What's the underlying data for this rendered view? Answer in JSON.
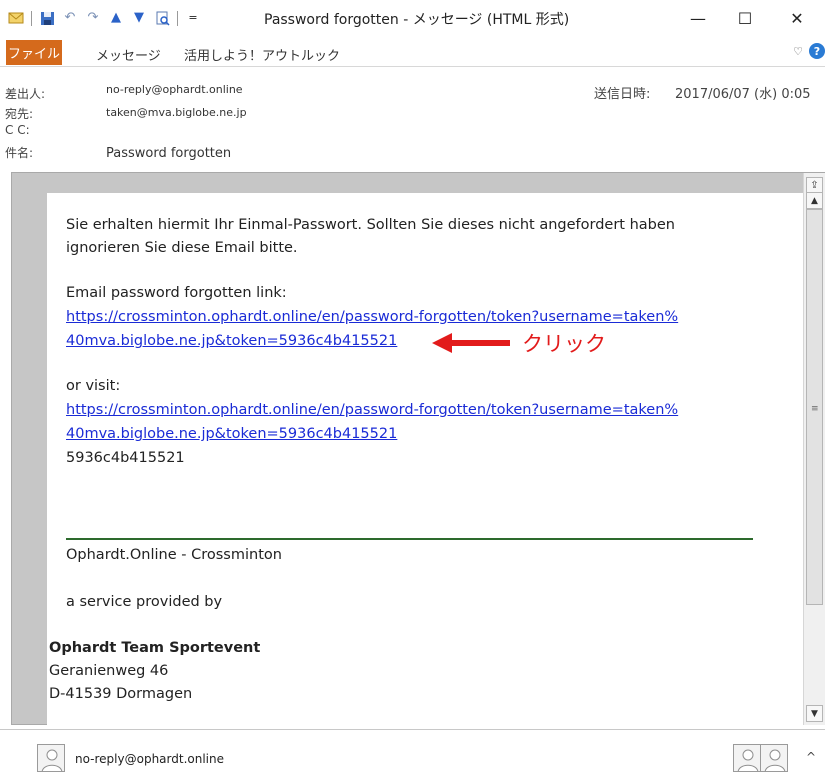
{
  "window": {
    "title": "Password forgotten - メッセージ (HTML 形式)",
    "minimize": "—",
    "maximize": "☐",
    "close": "✕"
  },
  "ribbon": {
    "file_tab": "ファイル",
    "tabs": [
      "メッセージ",
      "活用しよう！アウトルック"
    ],
    "collapse_icon": "♡",
    "help_icon": "?"
  },
  "headers": {
    "from_label": "差出人:",
    "from_value": "no-reply@ophardt.online",
    "to_label": "宛先:",
    "to_value": "taken@mva.biglobe.ne.jp",
    "cc_label": "C C:",
    "subject_label": "件名:",
    "subject_value": "Password forgotten",
    "sent_label": "送信日時:",
    "sent_value": "2017/06/07 (水) 0:05"
  },
  "message": {
    "intro_line1": "Sie erhalten hiermit Ihr Einmal-Passwort. Sollten Sie dieses nicht angefordert haben",
    "intro_line2": "ignorieren Sie diese Email bitte.",
    "link_label": "Email password forgotten link:",
    "link1_line1": "https://crossminton.ophardt.online/en/password-forgotten/token?username=taken%",
    "link1_line2": "40mva.biglobe.ne.jp&token=5936c4b415521",
    "or_visit": "or visit:",
    "link2_line1": "https://crossminton.ophardt.online/en/password-forgotten/token?username=taken%",
    "link2_line2": "40mva.biglobe.ne.jp&token=5936c4b415521",
    "token": "5936c4b415521",
    "footer_brand": "Ophardt.Online - Crossminton",
    "service_by": "a service provided by",
    "company": "Ophardt Team Sportevent",
    "street": "Geranienweg 46",
    "city": "D-41539 Dormagen"
  },
  "annotation": {
    "label": "クリック",
    "color": "#e21b1b"
  },
  "people_pane": {
    "sender": "no-reply@ophardt.online",
    "expand_icon": "^"
  },
  "colors": {
    "file_tab": "#d56a1c",
    "link": "#1a2bd6",
    "divider": "#2d6a2d"
  }
}
